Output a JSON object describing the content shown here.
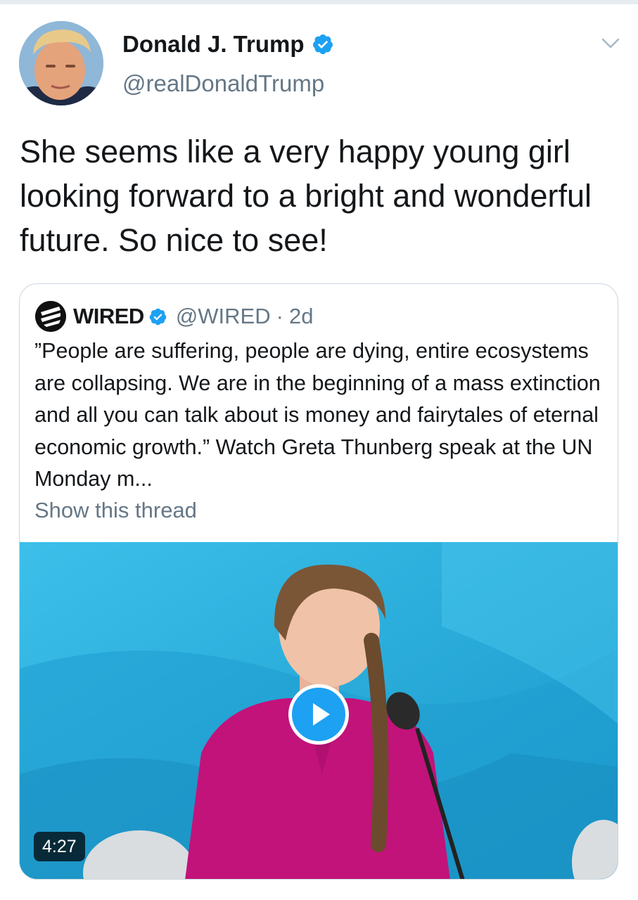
{
  "tweet": {
    "author_name": "Donald J. Trump",
    "author_handle": "@realDonaldTrump",
    "text": "She seems like a very happy young girl looking forward to a bright and wonderful future. So nice to see!"
  },
  "quoted": {
    "author_name": "WIRED",
    "author_handle": "@WIRED",
    "separator": "·",
    "time": "2d",
    "text": "”People are suffering, people are dying, entire ecosystems are collapsing. We are in the beginning of a mass extinction and all you can talk about is money and fairytales of eternal economic growth.” Watch Greta Thunberg speak at the UN Monday m...",
    "show_thread": "Show this thread",
    "video_duration": "4:27"
  },
  "icons": {
    "verified": "verified-badge-icon",
    "menu": "chevron-down-icon",
    "play": "play-icon"
  },
  "colors": {
    "brand_blue": "#1da1f2",
    "secondary_text": "#657786",
    "border": "#ccd6dd"
  }
}
